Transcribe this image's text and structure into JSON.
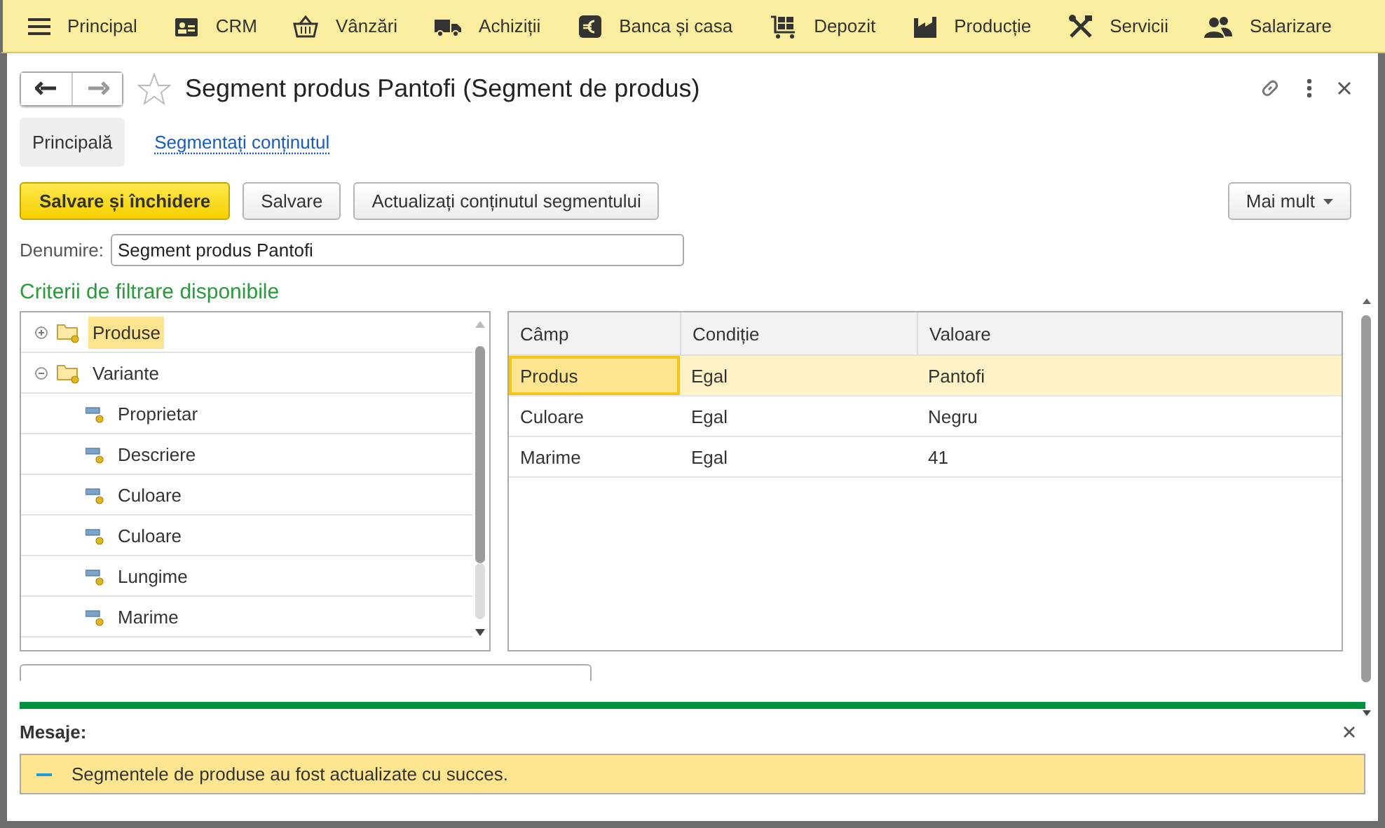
{
  "menu": [
    {
      "label": "Principal"
    },
    {
      "label": "CRM"
    },
    {
      "label": "Vânzări"
    },
    {
      "label": "Achiziții"
    },
    {
      "label": "Banca și casa"
    },
    {
      "label": "Depozit"
    },
    {
      "label": "Producție"
    },
    {
      "label": "Servicii"
    },
    {
      "label": "Salarizare"
    }
  ],
  "form": {
    "title": "Segment produs Pantofi (Segment de produs)",
    "tabs": [
      {
        "label": "Principală",
        "selected": true
      },
      {
        "label": "Segmentați conținutul",
        "selected": false
      }
    ],
    "toolbar": [
      {
        "label": "Salvare și închidere",
        "kind": "primary"
      },
      {
        "label": "Salvare",
        "kind": "normal"
      },
      {
        "label": "Actualizați conținutul segmentului",
        "kind": "normal"
      }
    ],
    "more_button": "Mai mult",
    "name_field": {
      "label": "Denumire:",
      "value": "Segment produs Pantofi"
    },
    "section_title": "Criterii de filtrare disponibile",
    "tree": [
      {
        "label": "Produse",
        "kind": "folder",
        "expanded": false,
        "selected": true
      },
      {
        "label": "Variante",
        "kind": "folder",
        "expanded": true,
        "selected": false,
        "children": [
          {
            "label": "Proprietar",
            "kind": "field",
            "selected": false
          },
          {
            "label": "Descriere",
            "kind": "field",
            "selected": false
          },
          {
            "label": "Culoare",
            "kind": "field",
            "selected": false
          },
          {
            "label": "Culoare",
            "kind": "field",
            "selected": false
          },
          {
            "label": "Lungime",
            "kind": "field",
            "selected": false
          },
          {
            "label": "Marime",
            "kind": "field",
            "selected": false
          }
        ]
      }
    ],
    "table": {
      "columns": [
        "Câmp",
        "Condiție",
        "Valoare"
      ],
      "rows": [
        {
          "cells": [
            "Produs",
            "Egal",
            "Pantofi"
          ],
          "selected": true
        },
        {
          "cells": [
            "Culoare",
            "Egal",
            "Negru"
          ],
          "selected": false
        },
        {
          "cells": [
            "Marime",
            "Egal",
            "41"
          ],
          "selected": false
        }
      ]
    }
  },
  "messages": {
    "title": "Mesaje:",
    "items": [
      "Segmentele de produse au fost actualizate cu succes."
    ]
  }
}
